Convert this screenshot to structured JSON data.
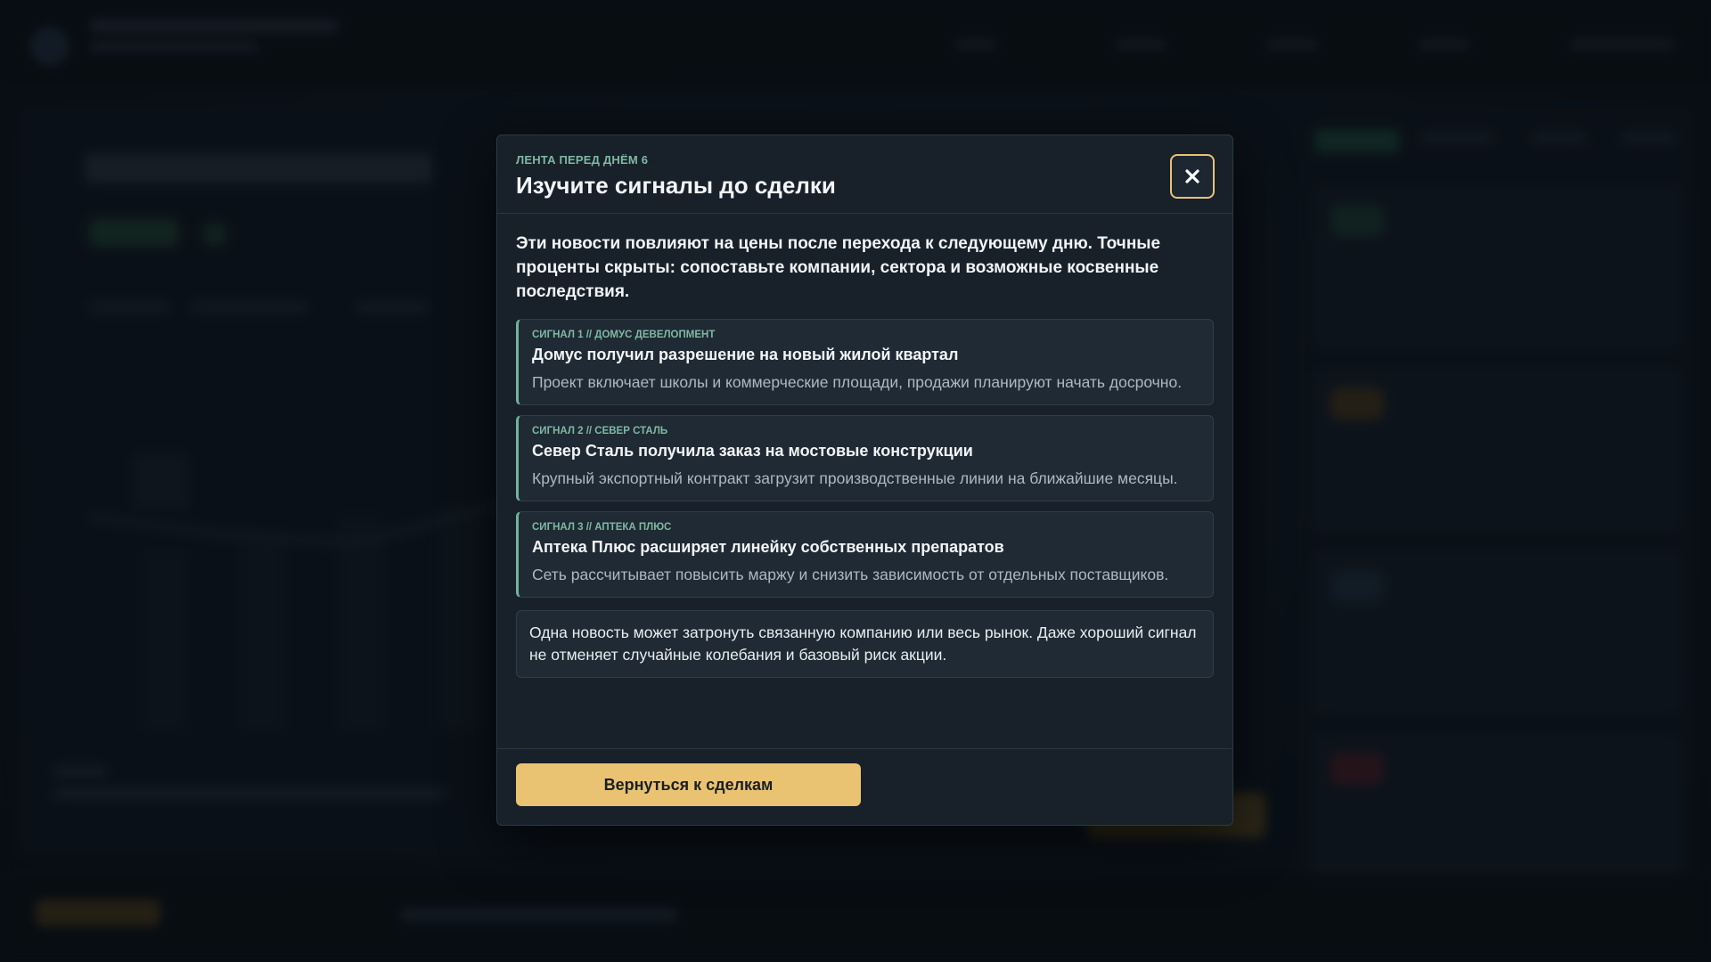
{
  "modal": {
    "eyebrow": "ЛЕНТА ПЕРЕД ДНЁМ 6",
    "title": "Изучите сигналы до сделки",
    "close_icon": "close-icon",
    "intro": "Эти новости повлияют на цены после перехода к следующему дню. Точные проценты скрыты: сопоставьте компании, сектора и возможные косвенные последствия.",
    "signals": [
      {
        "tag": "СИГНАЛ 1 // ДОМУС ДЕВЕЛОПМЕНТ",
        "title": "Домус получил разрешение на новый жилой квартал",
        "text": "Проект включает школы и коммерческие площади, продажи планируют начать досрочно."
      },
      {
        "tag": "СИГНАЛ 2 // СЕВЕР СТАЛЬ",
        "title": "Север Сталь получила заказ на мостовые конструкции",
        "text": "Крупный экспортный контракт загрузит производственные линии на ближайшие месяцы."
      },
      {
        "tag": "СИГНАЛ 3 // АПТЕКА ПЛЮС",
        "title": "Аптека Плюс расширяет линейку собственных препаратов",
        "text": "Сеть рассчитывает повысить маржу и снизить зависимость от отдельных поставщиков."
      }
    ],
    "note": "Одна новость может затронуть связанную компанию или весь рынок. Даже хороший сигнал не отменяет случайные колебания и базовый риск акции.",
    "primary_button": "Вернуться к сделкам"
  },
  "colors": {
    "accent": "#e9c272",
    "signal_accent": "#6fb39b",
    "modal_bg": "#182029",
    "card_bg": "#1f2a34"
  }
}
